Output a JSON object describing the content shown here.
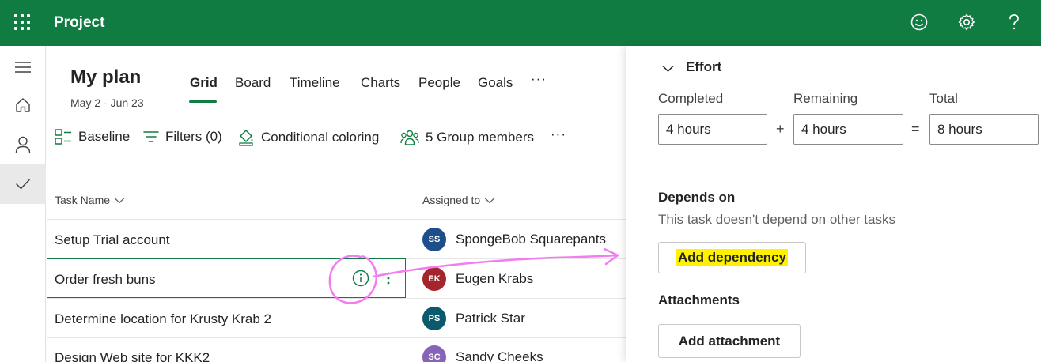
{
  "app": {
    "title": "Project"
  },
  "plan": {
    "title": "My plan",
    "dates": "May 2 - Jun 23"
  },
  "tabs": [
    {
      "label": "Grid",
      "active": true
    },
    {
      "label": "Board"
    },
    {
      "label": "Timeline"
    },
    {
      "label": "Charts"
    },
    {
      "label": "People"
    },
    {
      "label": "Goals"
    },
    {
      "label": "···"
    }
  ],
  "toolbar": {
    "baseline": "Baseline",
    "filters": "Filters (0)",
    "conditional": "Conditional coloring",
    "members": "5 Group members",
    "more": "···"
  },
  "grid": {
    "col_task": "Task Name",
    "col_assigned": "Assigned to",
    "rows": [
      {
        "task": "Setup Trial account",
        "initials": "SS",
        "assignee": "SpongeBob Squarepants",
        "color": "#1f4e8c"
      },
      {
        "task": "Order fresh buns",
        "initials": "EK",
        "assignee": "Eugen Krabs",
        "color": "#a4262c"
      },
      {
        "task": "Determine location for Krusty Krab 2",
        "initials": "PS",
        "assignee": "Patrick Star",
        "color": "#0b5a6b"
      },
      {
        "task": "Design Web site for KKK2",
        "initials": "SC",
        "assignee": "Sandy Cheeks",
        "color": "#8764b8"
      }
    ]
  },
  "panel": {
    "effort_title": "Effort",
    "completed_label": "Completed",
    "remaining_label": "Remaining",
    "total_label": "Total",
    "completed_value": "4 hours",
    "remaining_value": "4 hours",
    "total_value": "8 hours",
    "plus": "+",
    "equals": "=",
    "depends_title": "Depends on",
    "depends_text": "This task doesn't depend on other tasks",
    "add_dependency": "Add dependency",
    "attachments_title": "Attachments",
    "add_attachment": "Add attachment"
  },
  "colors": {
    "brand": "#107c41",
    "annotation": "#f37cf0",
    "highlight": "#fff200"
  }
}
